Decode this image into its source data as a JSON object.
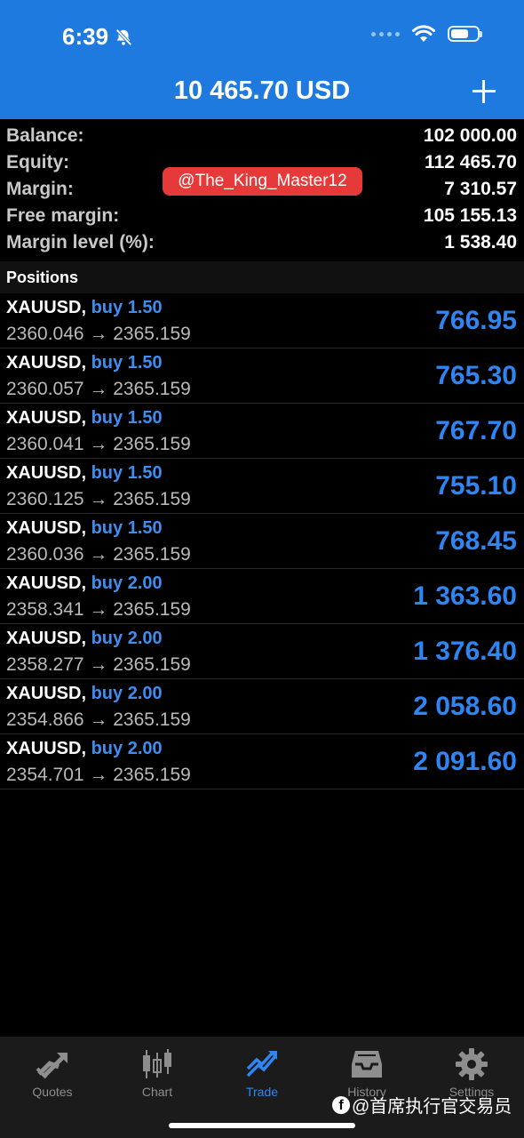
{
  "status_bar": {
    "time": "6:39"
  },
  "header": {
    "title": "10 465.70 USD"
  },
  "summary": [
    {
      "label": "Balance:",
      "value": "102 000.00"
    },
    {
      "label": "Equity:",
      "value": "112 465.70"
    },
    {
      "label": "Margin:",
      "value": "7 310.57"
    },
    {
      "label": "Free margin:",
      "value": "105 155.13"
    },
    {
      "label": "Margin level (%):",
      "value": "1 538.40"
    }
  ],
  "watermark": "@The_King_Master12",
  "positions_header": "Positions",
  "positions": [
    {
      "symbol": "XAUUSD,",
      "side": "buy 1.50",
      "prices": "2360.046 → 2365.159",
      "profit": "766.95"
    },
    {
      "symbol": "XAUUSD,",
      "side": "buy 1.50",
      "prices": "2360.057 → 2365.159",
      "profit": "765.30"
    },
    {
      "symbol": "XAUUSD,",
      "side": "buy 1.50",
      "prices": "2360.041 → 2365.159",
      "profit": "767.70"
    },
    {
      "symbol": "XAUUSD,",
      "side": "buy 1.50",
      "prices": "2360.125 → 2365.159",
      "profit": "755.10"
    },
    {
      "symbol": "XAUUSD,",
      "side": "buy 1.50",
      "prices": "2360.036 → 2365.159",
      "profit": "768.45"
    },
    {
      "symbol": "XAUUSD,",
      "side": "buy 2.00",
      "prices": "2358.341 → 2365.159",
      "profit": "1 363.60"
    },
    {
      "symbol": "XAUUSD,",
      "side": "buy 2.00",
      "prices": "2358.277 → 2365.159",
      "profit": "1 376.40"
    },
    {
      "symbol": "XAUUSD,",
      "side": "buy 2.00",
      "prices": "2354.866 → 2365.159",
      "profit": "2 058.60"
    },
    {
      "symbol": "XAUUSD,",
      "side": "buy 2.00",
      "prices": "2354.701 → 2365.159",
      "profit": "2 091.60"
    }
  ],
  "tabs": [
    {
      "label": "Quotes",
      "icon": "quotes-icon"
    },
    {
      "label": "Chart",
      "icon": "chart-icon"
    },
    {
      "label": "Trade",
      "icon": "trade-icon",
      "active": true
    },
    {
      "label": "History",
      "icon": "history-icon"
    },
    {
      "label": "Settings",
      "icon": "gear-icon"
    }
  ],
  "footer_watermark": "@首席执行官交易员",
  "colors": {
    "header_blue": "#1f7ae0",
    "profit_blue": "#2f86f2",
    "buy_blue": "#3d8ef0",
    "watermark_red": "#e63a3a"
  }
}
